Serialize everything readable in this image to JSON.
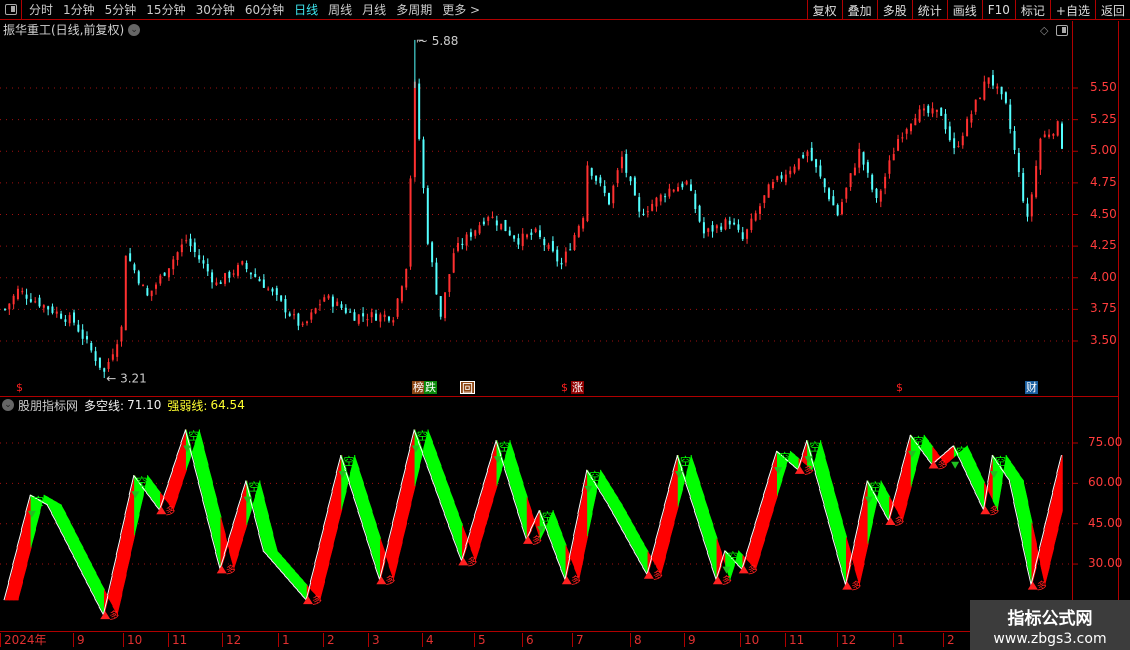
{
  "toolbar": {
    "periods": [
      "分时",
      "1分钟",
      "5分钟",
      "15分钟",
      "30分钟",
      "60分钟",
      "日线",
      "周线",
      "月线",
      "多周期",
      "更多 >"
    ],
    "active_period": "日线",
    "buttons": [
      "复权",
      "叠加",
      "多股",
      "统计",
      "画线",
      "F10",
      "标记",
      "+自选",
      "返回"
    ]
  },
  "main": {
    "title": "振华重工(日线,前复权)",
    "price_ticks": [
      "5.50",
      "5.25",
      "5.00",
      "4.75",
      "4.50",
      "4.25",
      "4.00",
      "3.75",
      "3.50"
    ],
    "high_label": "5.88",
    "low_label": "3.21",
    "markers": [
      {
        "text": "$",
        "type": "dollar"
      },
      {
        "text": "榜",
        "type": "bang"
      },
      {
        "text": "跌",
        "type": "die"
      },
      {
        "text": "回",
        "type": "hui"
      },
      {
        "text": "$",
        "type": "dollar"
      },
      {
        "text": "涨",
        "type": "zhang"
      },
      {
        "text": "$",
        "type": "dollar"
      },
      {
        "text": "财",
        "type": "cai"
      }
    ],
    "up_color": "#ff3030",
    "down_color": "#54ffff"
  },
  "chart_data": [
    {
      "type": "candlestick",
      "bar_count": 246,
      "close_waypoints": [
        [
          0,
          3.75
        ],
        [
          3,
          3.9
        ],
        [
          9,
          3.78
        ],
        [
          16,
          3.65
        ],
        [
          23,
          3.25
        ],
        [
          27,
          3.6
        ],
        [
          28,
          4.2
        ],
        [
          33,
          3.85
        ],
        [
          42,
          4.3
        ],
        [
          49,
          3.95
        ],
        [
          55,
          4.1
        ],
        [
          60,
          3.95
        ],
        [
          69,
          3.6
        ],
        [
          74,
          3.85
        ],
        [
          81,
          3.7
        ],
        [
          90,
          3.7
        ],
        [
          93,
          4.1
        ],
        [
          95,
          5.5
        ],
        [
          98,
          4.3
        ],
        [
          101,
          3.7
        ],
        [
          104,
          4.2
        ],
        [
          112,
          4.5
        ],
        [
          119,
          4.3
        ],
        [
          123,
          4.35
        ],
        [
          129,
          4.1
        ],
        [
          134,
          4.5
        ],
        [
          135,
          4.9
        ],
        [
          140,
          4.6
        ],
        [
          143,
          4.95
        ],
        [
          147,
          4.5
        ],
        [
          154,
          4.7
        ],
        [
          158,
          4.75
        ],
        [
          162,
          4.35
        ],
        [
          168,
          4.45
        ],
        [
          171,
          4.3
        ],
        [
          177,
          4.7
        ],
        [
          186,
          5.0
        ],
        [
          193,
          4.5
        ],
        [
          198,
          5.0
        ],
        [
          202,
          4.6
        ],
        [
          207,
          5.1
        ],
        [
          211,
          5.3
        ],
        [
          217,
          5.3
        ],
        [
          220,
          5.0
        ],
        [
          228,
          5.6
        ],
        [
          232,
          5.35
        ],
        [
          234,
          5.0
        ],
        [
          237,
          4.45
        ],
        [
          240,
          5.1
        ],
        [
          244,
          5.2
        ],
        [
          245,
          5.05
        ]
      ],
      "high": 5.88,
      "low": 3.21,
      "ylim": [
        3.2,
        5.9
      ]
    },
    {
      "type": "area",
      "title": "股朋指标网",
      "series": [
        {
          "name": "多空线",
          "last": 71.1
        },
        {
          "name": "强弱线",
          "last": 64.54
        }
      ],
      "bar_count": 246,
      "waypoints": [
        [
          0,
          16.6
        ],
        [
          6,
          55.7
        ],
        [
          10,
          52
        ],
        [
          23,
          11
        ],
        [
          30,
          63
        ],
        [
          36,
          50
        ],
        [
          42,
          80
        ],
        [
          50,
          28
        ],
        [
          56,
          61
        ],
        [
          60,
          35
        ],
        [
          70,
          16.6
        ],
        [
          78,
          70.5
        ],
        [
          87,
          24
        ],
        [
          95,
          80
        ],
        [
          106,
          31
        ],
        [
          114,
          76
        ],
        [
          121,
          39
        ],
        [
          124,
          50
        ],
        [
          130,
          24
        ],
        [
          135,
          65
        ],
        [
          140,
          52
        ],
        [
          149,
          26
        ],
        [
          156,
          70.5
        ],
        [
          165,
          24
        ],
        [
          167,
          35
        ],
        [
          171,
          28
        ],
        [
          179,
          72
        ],
        [
          184,
          65
        ],
        [
          186,
          76
        ],
        [
          195,
          22
        ],
        [
          200,
          61
        ],
        [
          205,
          46
        ],
        [
          210,
          78
        ],
        [
          215,
          67
        ],
        [
          220,
          74
        ],
        [
          227,
          50
        ],
        [
          229,
          70.5
        ],
        [
          233,
          61
        ],
        [
          238,
          22
        ],
        [
          245,
          70.5
        ]
      ],
      "ticks": [
        "75.00",
        "60.00",
        "45.00",
        "30.00"
      ],
      "ylim": [
        5,
        85
      ],
      "signal_up": "多",
      "signal_down": "空",
      "rise_color": "#ff0000",
      "fall_color": "#00ff00"
    }
  ],
  "indicator": {
    "name": "股朋指标网",
    "line1_label": "多空线:",
    "line1_value": "71.10",
    "line2_label": "强弱线:",
    "line2_value": "64.54"
  },
  "date_axis": [
    "2024年",
    "9",
    "10",
    "11",
    "12",
    "1",
    "2",
    "3",
    "4",
    "5",
    "6",
    "7",
    "8",
    "9",
    "10",
    "11",
    "12",
    "1",
    "2"
  ],
  "watermark": {
    "line1": "指标公式网",
    "line2": "www.zbgs3.com"
  }
}
